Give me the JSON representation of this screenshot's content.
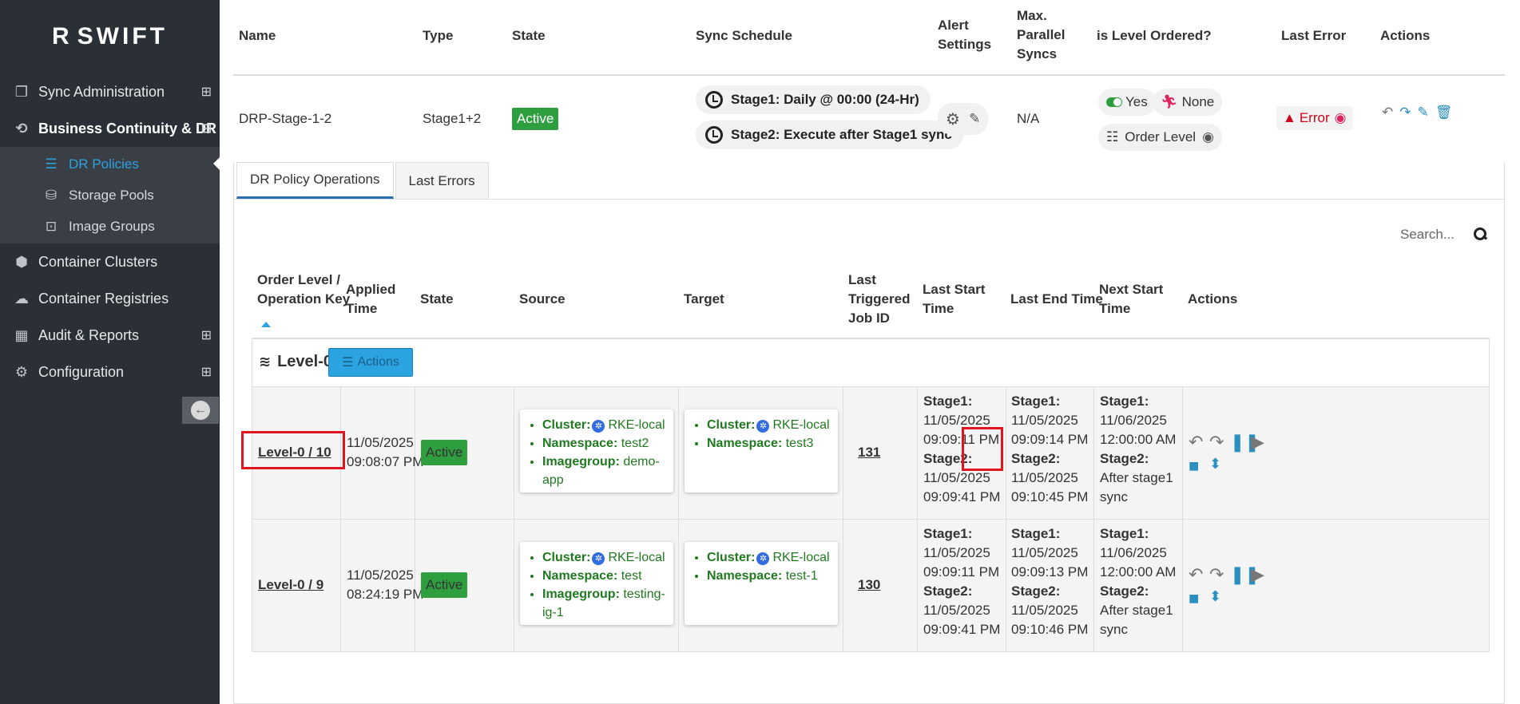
{
  "app": {
    "logo_text": "SWIFT",
    "logo_letter": "R"
  },
  "colors": {
    "sidebar_bg": "#2b2f36",
    "accent": "#2aa3e0",
    "active_green": "#2e9e3f",
    "error_red": "#d0021b",
    "highlight_box": "#e0141e"
  },
  "sidebar": {
    "items": [
      {
        "label": "Sync Administration",
        "icon": "copy-icon",
        "toggle": "⊞"
      },
      {
        "label": "Business Continuity & DR",
        "icon": "dr-icon",
        "toggle": "⊟"
      },
      {
        "label": "Container Clusters",
        "icon": "cube-icon"
      },
      {
        "label": "Container Registries",
        "icon": "cloud-icon"
      },
      {
        "label": "Audit & Reports",
        "icon": "table-icon",
        "toggle": "⊞"
      },
      {
        "label": "Configuration",
        "icon": "gears-icon",
        "toggle": "⊞"
      }
    ],
    "subitems": [
      {
        "label": "DR Policies",
        "icon": "list-icon",
        "active": true
      },
      {
        "label": "Storage Pools",
        "icon": "database-icon"
      },
      {
        "label": "Image Groups",
        "icon": "image-group-icon"
      }
    ]
  },
  "policy_table": {
    "headers": {
      "name": "Name",
      "type": "Type",
      "state": "State",
      "sync_schedule": "Sync Schedule",
      "alert1": "Alert",
      "alert2": "Settings",
      "maxp1": "Max.",
      "maxp2": "Parallel",
      "maxp3": "Syncs",
      "level_ordered": "is Level Ordered?",
      "last_error": "Last Error",
      "actions": "Actions"
    },
    "row": {
      "name": "DRP-Stage-1-2",
      "type": "Stage1+2",
      "state": "Active",
      "schedule1": "Stage1: Daily @ 00:00 (24-Hr)",
      "schedule2": "Stage2: Execute after Stage1 sync",
      "max_parallel": "N/A",
      "level_ordered": "Yes",
      "none_label": "None",
      "order_level": "Order Level",
      "last_error": "Error"
    }
  },
  "tabs": [
    {
      "label": "DR Policy Operations",
      "active": true
    },
    {
      "label": "Last Errors"
    }
  ],
  "search": {
    "placeholder": "Search..."
  },
  "ops_table": {
    "headers": {
      "key1": "Order Level /",
      "key2": "Operation Key",
      "applied1": "Applied",
      "applied2": "Time",
      "state": "State",
      "source": "Source",
      "target": "Target",
      "job1": "Last",
      "job2": "Triggered",
      "job3": "Job ID",
      "start1": "Last Start",
      "start2": "Time",
      "end": "Last End Time",
      "next1": "Next Start",
      "next2": "Time",
      "actions": "Actions"
    },
    "level": {
      "label": "Level-0",
      "actions_label": "Actions"
    },
    "labels": {
      "cluster": "Cluster:",
      "namespace": "Namespace:",
      "imagegroup": "Imagegroup:",
      "stage1": "Stage1:",
      "stage2": "Stage2:"
    },
    "rows": [
      {
        "key": "Level-0 / 10",
        "applied_date": "11/05/2025",
        "applied_time": "09:08:07 PM",
        "state": "Active",
        "source": {
          "cluster": "RKE-local",
          "namespace": "test2",
          "imagegroup": "demo-app"
        },
        "target": {
          "cluster": "RKE-local",
          "namespace": "test3"
        },
        "job_id": "131",
        "start": {
          "s1_date": "11/05/2025",
          "s1_time": "09:09:11 PM",
          "s2_date": "11/05/2025",
          "s2_time": "09:09:41 PM"
        },
        "end": {
          "s1_date": "11/05/2025",
          "s1_time": "09:09:14 PM",
          "s2_date": "11/05/2025",
          "s2_time": "09:10:45 PM"
        },
        "next": {
          "s1_date": "11/06/2025",
          "s1_time": "12:00:00 AM",
          "s2_a": "After stage1",
          "s2_b": "sync"
        }
      },
      {
        "key": "Level-0 / 9",
        "applied_date": "11/05/2025",
        "applied_time": "08:24:19 PM",
        "state": "Active",
        "source": {
          "cluster": "RKE-local",
          "namespace": "test",
          "imagegroup": "testing-ig-1"
        },
        "target": {
          "cluster": "RKE-local",
          "namespace": "test-1"
        },
        "job_id": "130",
        "start": {
          "s1_date": "11/05/2025",
          "s1_time": "09:09:11 PM",
          "s2_date": "11/05/2025",
          "s2_time": "09:09:41 PM"
        },
        "end": {
          "s1_date": "11/05/2025",
          "s1_time": "09:09:13 PM",
          "s2_date": "11/05/2025",
          "s2_time": "09:10:46 PM"
        },
        "next": {
          "s1_date": "11/06/2025",
          "s1_time": "12:00:00 AM",
          "s2_a": "After stage1",
          "s2_b": "sync"
        }
      }
    ]
  }
}
